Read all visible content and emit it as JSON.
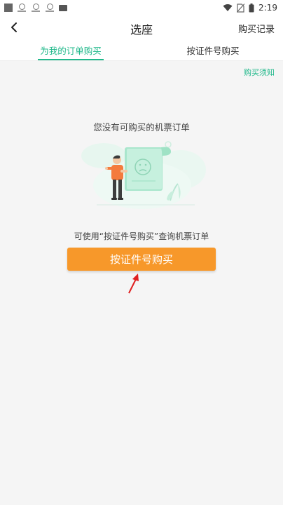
{
  "status_bar": {
    "time": "2:19",
    "icons": [
      "app-square-icon",
      "app-notification-icon",
      "app-notification-icon",
      "app-notification-icon",
      "app-dark-icon",
      "wifi-icon",
      "no-sim-icon",
      "battery-icon"
    ]
  },
  "header": {
    "title": "选座",
    "records_label": "购买记录",
    "back_icon": "chevron-left-icon"
  },
  "tabs": [
    {
      "label": "为我的订单购买",
      "active": true
    },
    {
      "label": "按证件号购买",
      "active": false
    }
  ],
  "notice_link": "购买须知",
  "empty_state": {
    "message": "您没有可购买的机票订单",
    "illustration": "person-with-document-illustration"
  },
  "hint": "可使用“按证件号购买”查询机票订单",
  "primary_button": "按证件号购买",
  "colors": {
    "accent": "#1fb88a",
    "button": "#f7982a",
    "annotation_arrow": "#e02020",
    "background": "#f5f5f5"
  }
}
